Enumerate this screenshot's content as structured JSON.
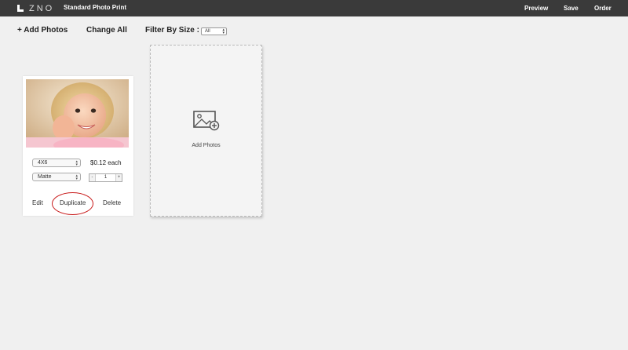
{
  "header": {
    "logo_text": "ZNO",
    "title": "Standard Photo Print",
    "nav": {
      "preview": "Preview",
      "save": "Save",
      "order": "Order"
    }
  },
  "toolbar": {
    "add_photos": "+ Add Photos",
    "change_all": "Change All",
    "filter_label": "Filter By Size :",
    "filter_value": "All"
  },
  "photo_card": {
    "size_value": "4X6",
    "finish_value": "Matte",
    "price": "$0.12 each",
    "quantity": "1",
    "actions": {
      "edit": "Edit",
      "duplicate": "Duplicate",
      "delete": "Delete"
    }
  },
  "add_panel": {
    "label": "Add Photos"
  },
  "colors": {
    "topbar": "#3a3a3a",
    "background": "#f0f0f0",
    "highlight_circle": "#c81a1a"
  },
  "icons": [
    "logo-icon",
    "add-image-icon",
    "select-arrows-icon"
  ]
}
